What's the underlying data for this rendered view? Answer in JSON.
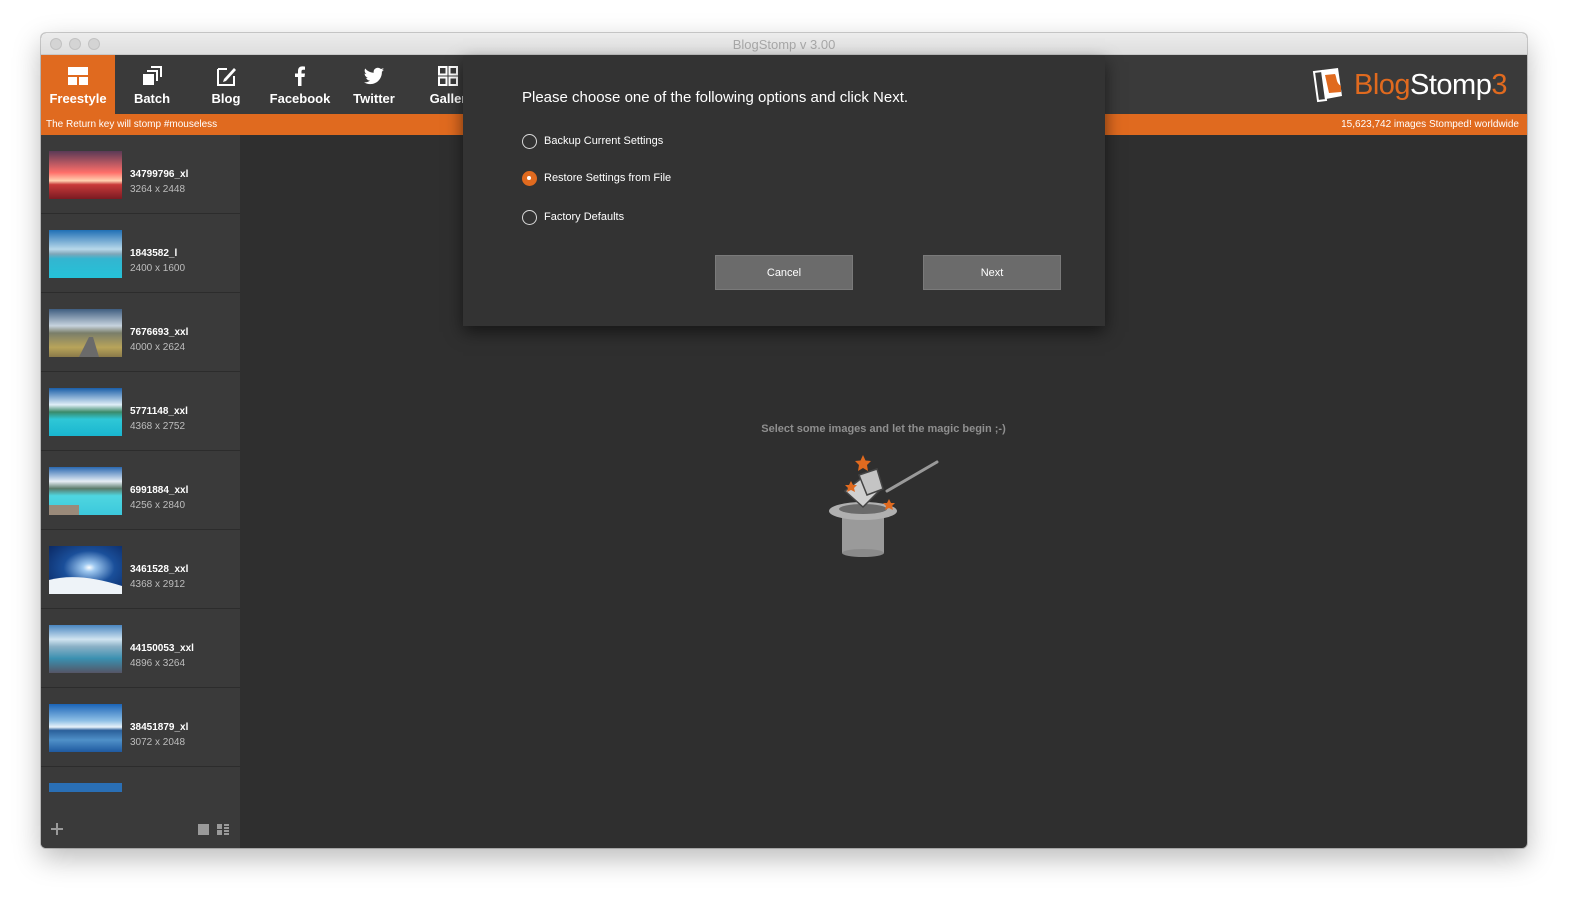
{
  "window": {
    "title": "BlogStomp v 3.00"
  },
  "toolbar": {
    "items": [
      {
        "label": "Freestyle",
        "icon": "freestyle-layout-icon",
        "active": true
      },
      {
        "label": "Batch",
        "icon": "batch-stack-icon",
        "active": false
      },
      {
        "label": "Blog",
        "icon": "blog-edit-icon",
        "active": false
      },
      {
        "label": "Facebook",
        "icon": "facebook-icon",
        "active": false
      },
      {
        "label": "Twitter",
        "icon": "twitter-icon",
        "active": false
      },
      {
        "label": "Galler",
        "icon": "gallery-grid-icon",
        "active": false
      }
    ]
  },
  "logo": {
    "text_white": "Blog",
    "text_white2": "Stomp",
    "text_orange": "3"
  },
  "orangebar": {
    "left_text": "The Return key will stomp #mouseless",
    "right_text": "15,623,742 images Stomped! worldwide"
  },
  "sidebar": {
    "images": [
      {
        "name": "34799796_xl",
        "size": "3264 x 2448"
      },
      {
        "name": "1843582_l",
        "size": "2400 x 1600"
      },
      {
        "name": "7676693_xxl",
        "size": "4000 x 2624"
      },
      {
        "name": "5771148_xxl",
        "size": "4368 x 2752"
      },
      {
        "name": "6991884_xxl",
        "size": "4256 x 2840"
      },
      {
        "name": "3461528_xxl",
        "size": "4368 x 2912"
      },
      {
        "name": "44150053_xxl",
        "size": "4896 x 3264"
      },
      {
        "name": "38451879_xl",
        "size": "3072 x 2048"
      }
    ],
    "footer": {
      "add_icon": "plus-icon",
      "view_icons": [
        "grid-view-icon",
        "list-view-icon"
      ]
    }
  },
  "main": {
    "hint": "Select some images and let the magic begin ;-)"
  },
  "dialog": {
    "title": "Please choose one of the following options and click Next.",
    "options": [
      {
        "label": "Backup Current Settings",
        "selected": false
      },
      {
        "label": "Restore Settings from File",
        "selected": true
      },
      {
        "label": "Factory Defaults",
        "selected": false
      }
    ],
    "cancel_label": "Cancel",
    "next_label": "Next"
  },
  "colors": {
    "accent": "#e06a1f",
    "toolbar_bg": "#3a3a3a",
    "content_bg": "#2f2f2f",
    "dialog_bg": "#333333"
  }
}
